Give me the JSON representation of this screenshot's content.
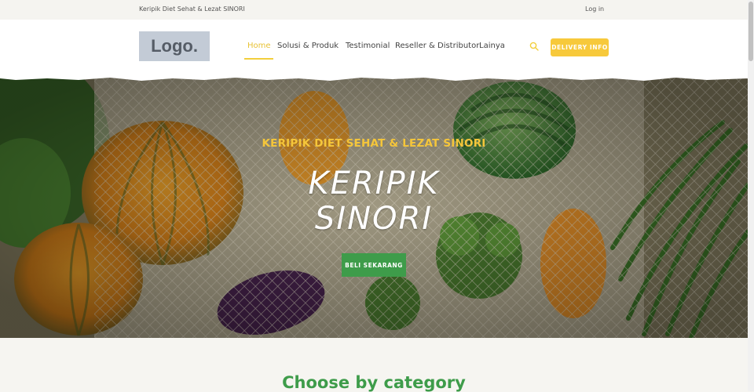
{
  "topbar": {
    "tagline": "Keripik Diet Sehat & Lezat SINORI",
    "login": "Log in"
  },
  "header": {
    "logo": "Logo.",
    "nav": [
      {
        "label": "Home",
        "active": true
      },
      {
        "label": "Solusi & Produk",
        "active": false
      },
      {
        "label": "Testimonial",
        "active": false
      },
      {
        "label": "Reseller & Distributor",
        "active": false
      },
      {
        "label": "Lainya",
        "active": false
      }
    ],
    "search_icon": "search-icon",
    "delivery_button": "DELIVERY INFO"
  },
  "hero": {
    "subtitle": "KERIPIK DIET SEHAT & LEZAT SINORI",
    "title_line1": "KERIPIK",
    "title_line2": "SINORI",
    "cta": "BELI SEKARANG"
  },
  "section": {
    "heading": "Choose by category"
  },
  "colors": {
    "accent_yellow": "#f7c93b",
    "brand_green": "#3e9c4a",
    "nav_active": "#e8c234"
  }
}
